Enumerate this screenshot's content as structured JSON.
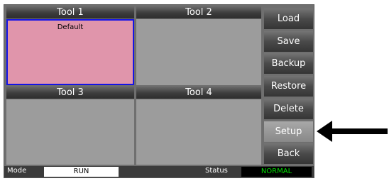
{
  "tools": [
    {
      "title": "Tool 1",
      "label": "Default"
    },
    {
      "title": "Tool 2",
      "label": ""
    },
    {
      "title": "Tool 3",
      "label": ""
    },
    {
      "title": "Tool 4",
      "label": ""
    }
  ],
  "buttons": {
    "load": "Load",
    "save": "Save",
    "backup": "Backup",
    "restore": "Restore",
    "delete": "Delete",
    "setup": "Setup",
    "back": "Back"
  },
  "status_bar": {
    "mode_label": "Mode",
    "mode_value": "RUN",
    "status_label": "Status",
    "status_value": "NORMAL"
  },
  "colors": {
    "selected_fill": "#e095ab",
    "selected_border": "#1414e6",
    "status_ok": "#00dd00"
  },
  "annotation": {
    "icon": "arrow-left-icon"
  }
}
